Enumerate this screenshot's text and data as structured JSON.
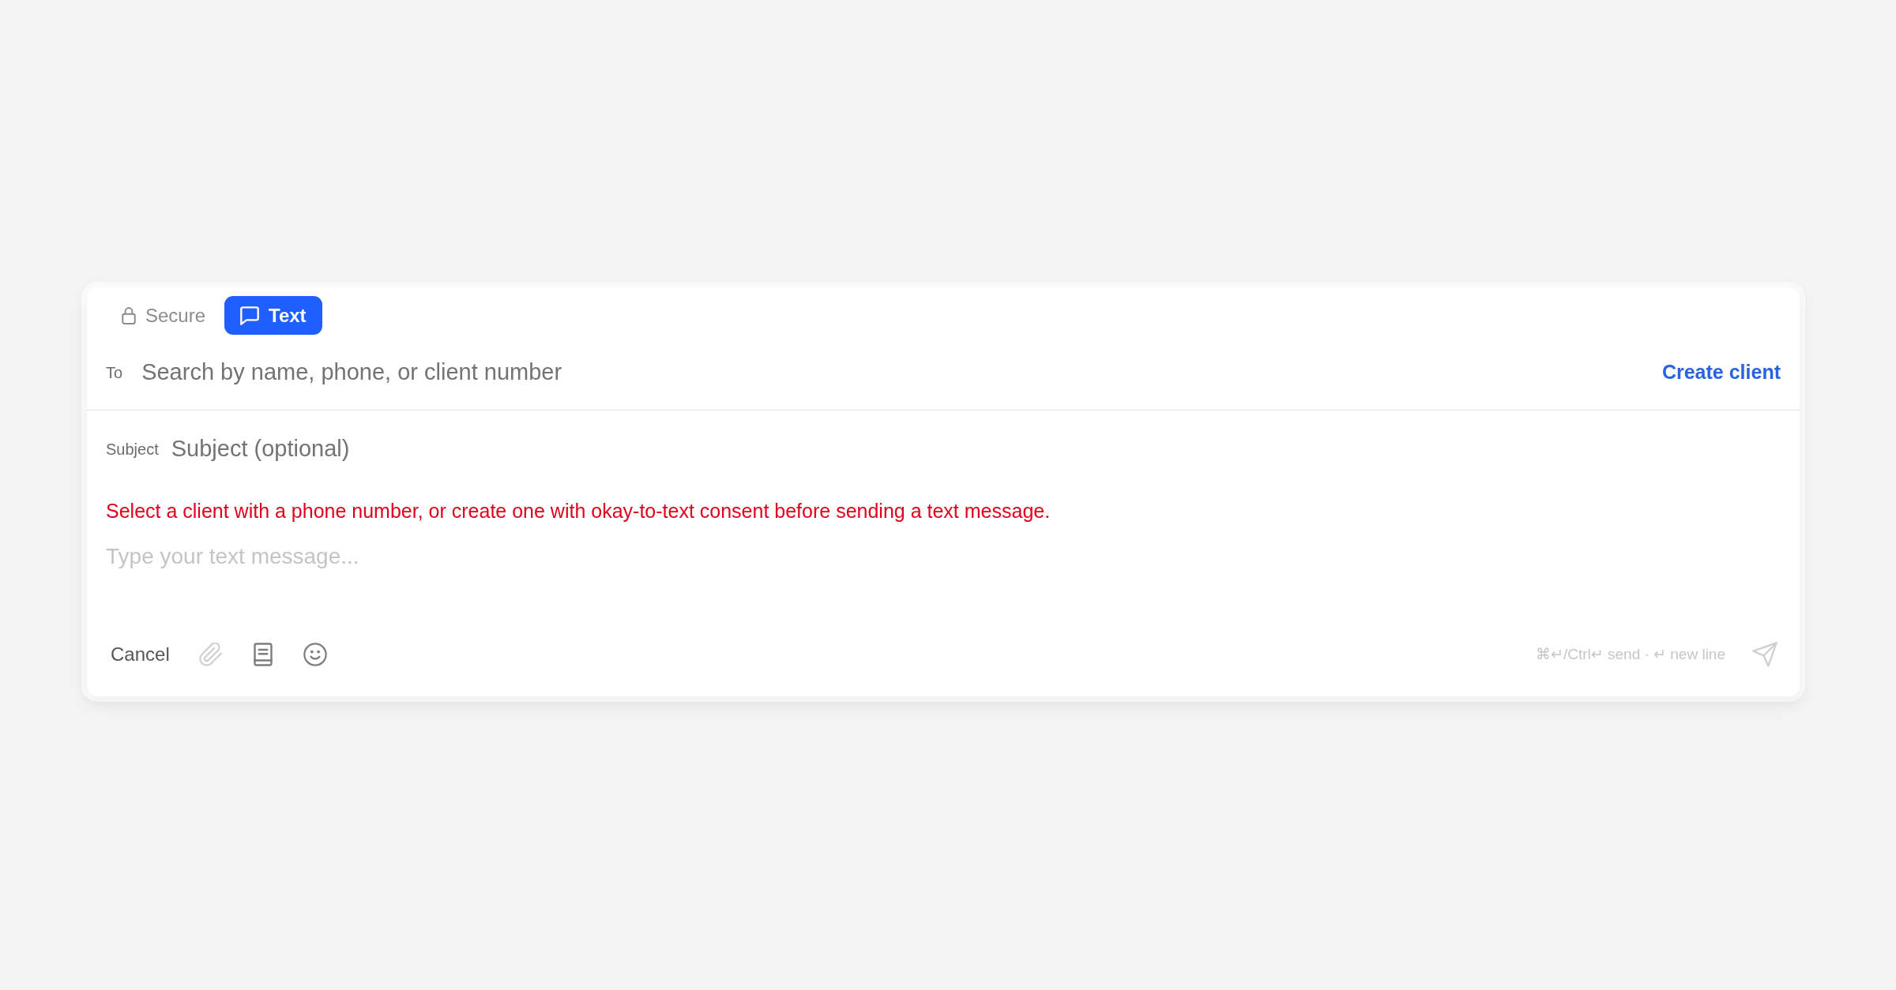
{
  "tabs": [
    {
      "label": "Secure",
      "selected": false
    },
    {
      "label": "Text",
      "selected": true
    }
  ],
  "to_field": {
    "label": "To",
    "placeholder": "Search by name, phone, or client number"
  },
  "create_client_link": "Create client",
  "subject_field": {
    "label": "Subject",
    "placeholder": "Subject (optional)"
  },
  "error_message": "Select a client with a phone number, or create one with okay-to-text consent before sending a text message.",
  "message_field": {
    "placeholder": "Type your text message..."
  },
  "cancel_button": "Cancel",
  "tools": [
    {
      "disabled": true
    },
    {
      "disabled": false
    },
    {
      "disabled": false
    }
  ],
  "keyboard_hint": "⌘↵/Ctrl↵ send · ↵ new line",
  "send_button": {
    "disabled": true
  }
}
